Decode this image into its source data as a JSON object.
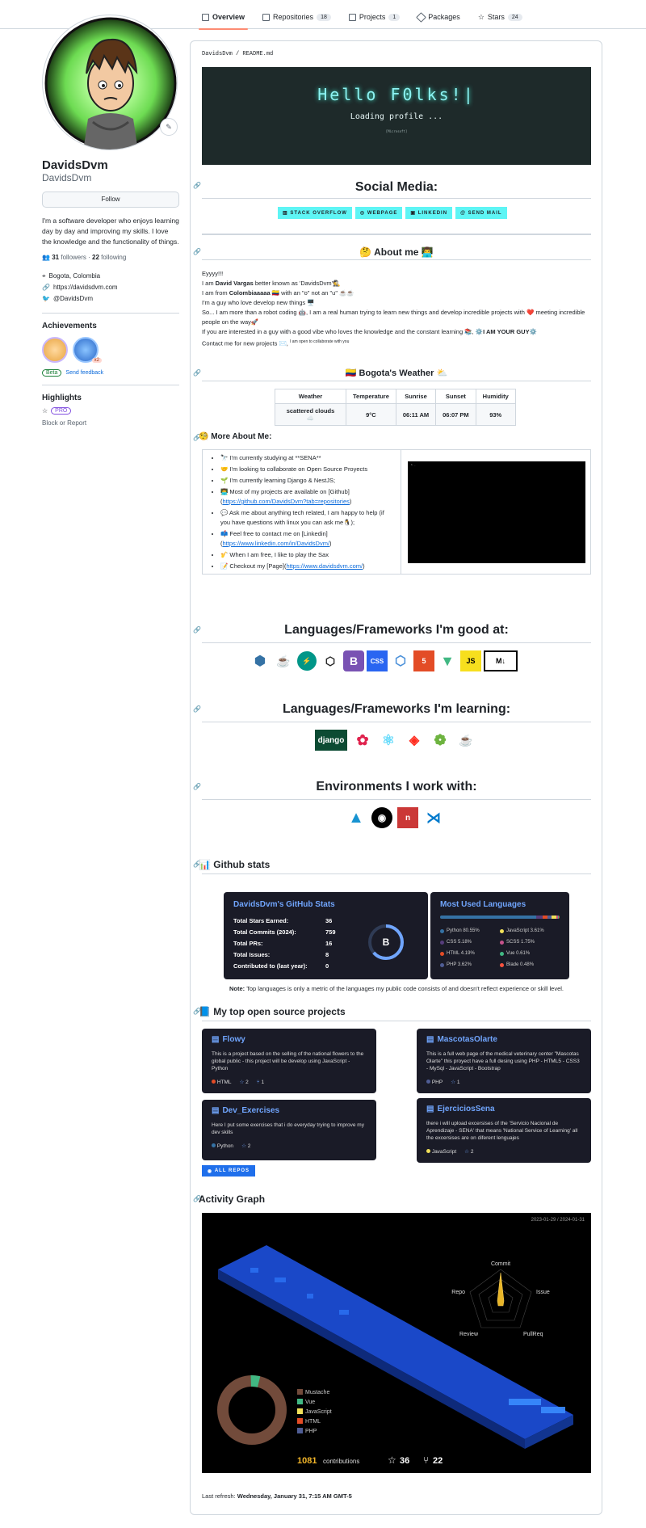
{
  "nav": {
    "tabs": [
      {
        "label": "Overview",
        "count": ""
      },
      {
        "label": "Repositories",
        "count": "18"
      },
      {
        "label": "Projects",
        "count": "1"
      },
      {
        "label": "Packages",
        "count": ""
      },
      {
        "label": "Stars",
        "count": "24"
      }
    ]
  },
  "profile": {
    "fullname": "DavidsDvm",
    "login": "DavidsDvm",
    "follow_label": "Follow",
    "bio": "I'm a software developer who enjoys learning day by day and improving my skills. I love the knowledge and the functionality of things.",
    "followers": "31",
    "followers_label": "followers",
    "following": "22",
    "following_label": "following",
    "location": "Bogota, Colombia",
    "website": "https://davidsdvm.com",
    "twitter": "@DavidsDvm",
    "achievements_title": "Achievements",
    "achievement_badge_count": "x2",
    "beta_label": "Beta",
    "feedback_label": "Send feedback",
    "highlights_title": "Highlights",
    "pro_label": "PRO",
    "block_label": "Block or Report"
  },
  "readme": {
    "path": "DavidsDvm / README.md",
    "typing_line1": "Hello F0lks!|",
    "typing_line2": "Loading profile ...",
    "typing_line3": "[Microsoft]",
    "social_title": "Social Media:",
    "social_badges": [
      "STACK OVERFLOW",
      "WEBPAGE",
      "LINKEDIN",
      "SEND MAIL"
    ],
    "about_title": "🤔 About me 👨‍💻",
    "about_lines": {
      "l1": "Eyyyy!!!",
      "l2a": "I am ",
      "l2b": "David Vargas",
      "l2c": " better known as 'DavidsDvm'🕵️",
      "l3a": "I am from ",
      "l3b": "Colombiaaaaa",
      "l3c": " 🇨🇴 with an \"o\" not an \"u\" ☕☕",
      "l4": "I'm a guy who love develop new things 🖥️",
      "l5": "So... I am more than a robot coding 🤖, I am a real human trying to learn new things and develop incredible projects with ❤️ meeting incredible people on the way🚀",
      "l6a": "If you are interested in a guy with a good vibe who loves the knowledge and the constant learning 📚, ⚙️",
      "l6b": "I AM YOUR GUY",
      "l6c": "⚙️",
      "l7": "Contact me for new projects ✉️,",
      "l7small": "I am open to collaborate with you"
    },
    "weather_title": "🇨🇴 Bogota's Weather ⛅",
    "weather_headers": [
      "Weather",
      "Temperature",
      "Sunrise",
      "Sunset",
      "Humidity"
    ],
    "weather_values": [
      "scattered clouds ☁️",
      "9°C",
      "06:11 AM",
      "06:07 PM",
      "93%"
    ],
    "more_title": "🧐 More About Me:",
    "more_items": [
      "🔭 I'm currently studying at **SENA**",
      "🤝 I'm looking to collaborate on Open Source Proyects",
      "🌱 I'm currently learning Django & NestJS;",
      "👨‍💻 Most of my projects are available on [Github]",
      "💬 Ask me about anything tech related, I am happy to help (if you have questions with linux you can ask me🐧);",
      "📫 Feel free to contact me on [Linkedin]",
      "🎷 When I am free, I like to play the Sax",
      "📝 Checkout my [Page]"
    ],
    "more_links": {
      "github": "https://github.com/DavidsDvm?tab=repositories",
      "linkedin": "https://www.linkedin.com/in/DavidsDvm/",
      "page": "https://www.davidsdvm.com/"
    },
    "good_title": "Languages/Frameworks I'm good at:",
    "learning_title": "Languages/Frameworks I'm learning:",
    "env_title": "Environments I work with:",
    "github_stats_title": "📊 Github stats",
    "stats": {
      "title": "DavidsDvm's GitHub Stats",
      "rows": [
        {
          "label": "Total Stars Earned:",
          "value": "36"
        },
        {
          "label": "Total Commits (2024):",
          "value": "759"
        },
        {
          "label": "Total PRs:",
          "value": "16"
        },
        {
          "label": "Total Issues:",
          "value": "8"
        },
        {
          "label": "Contributed to (last year):",
          "value": "0"
        }
      ],
      "grade": "B"
    },
    "langs": {
      "title": "Most Used Languages",
      "items": [
        {
          "name": "Python 80.55%",
          "color": "#3572A5"
        },
        {
          "name": "JavaScript 3.61%",
          "color": "#f1e05a"
        },
        {
          "name": "CSS 5.18%",
          "color": "#563d7c"
        },
        {
          "name": "SCSS 1.75%",
          "color": "#c6538c"
        },
        {
          "name": "HTML 4.19%",
          "color": "#e34c26"
        },
        {
          "name": "Vue 0.61%",
          "color": "#41b883"
        },
        {
          "name": "PHP 3.62%",
          "color": "#4F5D95"
        },
        {
          "name": "Blade 0.48%",
          "color": "#f7523f"
        }
      ]
    },
    "note_bold": "Note:",
    "note_text": " Top languages is only a metric of the languages my public code consists of and doesn't reflect experience or skill level.",
    "projects_title": "📘 My top open source projects",
    "projects": [
      {
        "name": "Flowy",
        "desc": "This is a project based on the selling of the national flowers to the global public - this project will be develop using JavaScript - Python",
        "lang": "HTML",
        "lang_color": "#e34c26",
        "stars": "2",
        "forks": "1"
      },
      {
        "name": "MascotasOlarte",
        "desc": "This is a full web page of the medical veterinary center \"Mascotas Olarte\" this proyect have a full desing using PHP - HTML5 - CSS3 - MySql - JavaScript - Bootstrap",
        "lang": "PHP",
        "lang_color": "#4F5D95",
        "stars": "1",
        "forks": ""
      },
      {
        "name": "Dev_Exercises",
        "desc": "Here I put some exercises that i do everyday trying to improve my dev skills",
        "lang": "Python",
        "lang_color": "#3572A5",
        "stars": "2",
        "forks": ""
      },
      {
        "name": "EjerciciosSena",
        "desc": "there i will upload excersises of the 'Servicio Nacional de Aprendizaje - SENA' that means 'National Service of Learning' all the excersises are on diferent lenguajes",
        "lang": "JavaScript",
        "lang_color": "#f1e05a",
        "stars": "2",
        "forks": ""
      }
    ],
    "all_repos": "ALL REPOS",
    "activity_title": "Activity Graph",
    "activity": {
      "date_range": "2023-01-29 / 2024-01-31",
      "radar_labels": [
        "Commit",
        "Issue",
        "PullReq",
        "Review",
        "Repo"
      ],
      "legend": [
        {
          "name": "Mustache",
          "color": "#724b3b"
        },
        {
          "name": "Vue",
          "color": "#41b883"
        },
        {
          "name": "JavaScript",
          "color": "#f1e05a"
        },
        {
          "name": "HTML",
          "color": "#e34c26"
        },
        {
          "name": "PHP",
          "color": "#4F5D95"
        }
      ],
      "contributions": "1081",
      "contributions_label": "contributions",
      "stars": "36",
      "forks": "22"
    },
    "refresh_label": "Last refresh: ",
    "refresh_value": "Wednesday, January 31, 7:15 AM GMT-5"
  }
}
